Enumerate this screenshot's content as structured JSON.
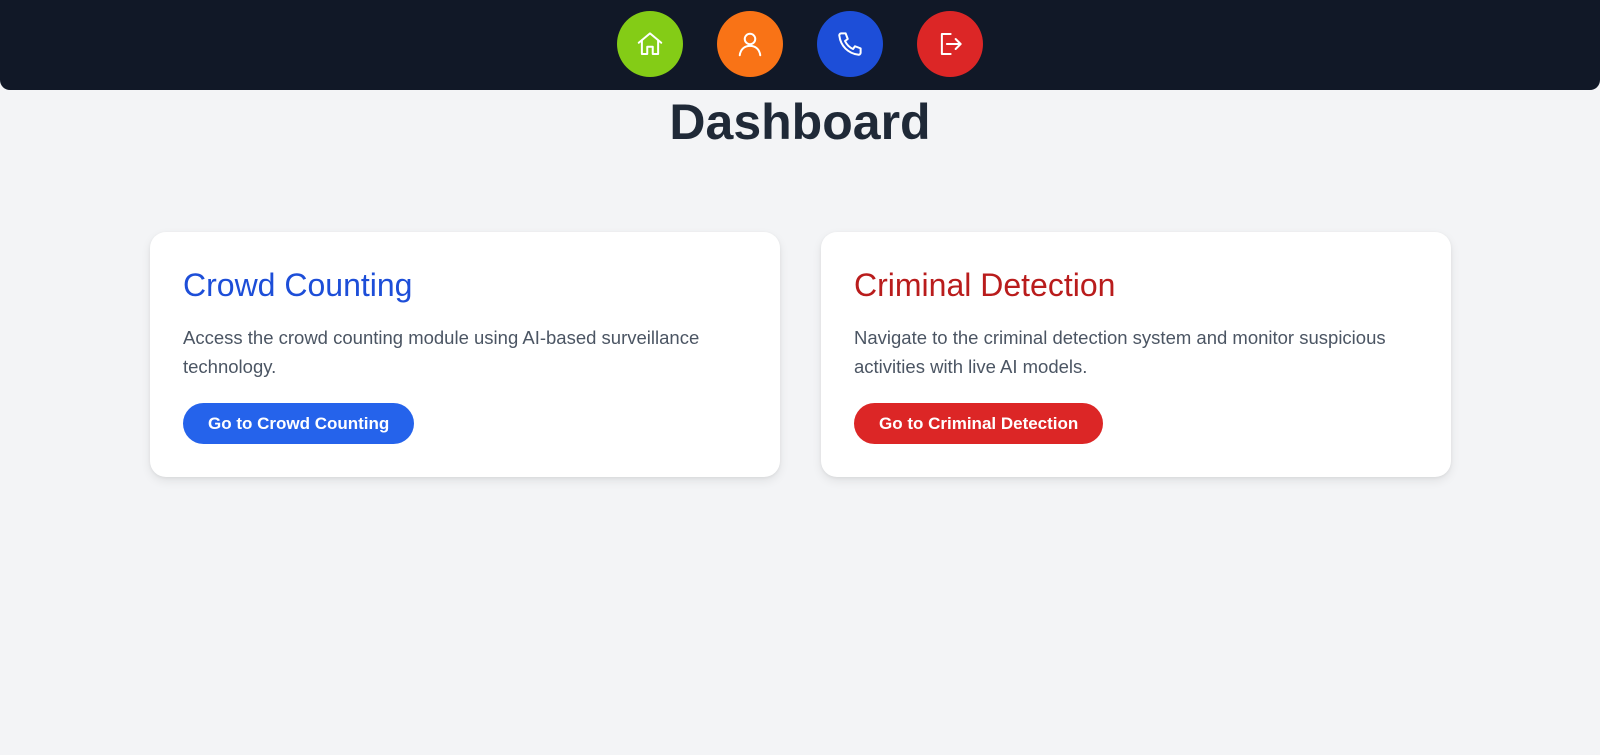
{
  "nav": {
    "items": [
      {
        "name": "home",
        "icon": "home-icon",
        "color": "#84cc16"
      },
      {
        "name": "profile",
        "icon": "user-icon",
        "color": "#f97316"
      },
      {
        "name": "contact",
        "icon": "phone-icon",
        "color": "#1d4ed8"
      },
      {
        "name": "logout",
        "icon": "logout-icon",
        "color": "#dc2626"
      }
    ]
  },
  "page": {
    "title": "Dashboard"
  },
  "cards": [
    {
      "title": "Crowd Counting",
      "description": "Access the crowd counting module using AI-based surveillance technology.",
      "button_label": "Go to Crowd Counting",
      "title_color": "#1d4ed8",
      "button_color": "#2563eb"
    },
    {
      "title": "Criminal Detection",
      "description": "Navigate to the criminal detection system and monitor suspicious activities with live AI models.",
      "button_label": "Go to Criminal Detection",
      "title_color": "#b91c1c",
      "button_color": "#dc2626"
    }
  ],
  "colors": {
    "background": "#f3f4f6",
    "navbar": "#111827",
    "title": "#1f2937",
    "body_text": "#4b5563"
  }
}
